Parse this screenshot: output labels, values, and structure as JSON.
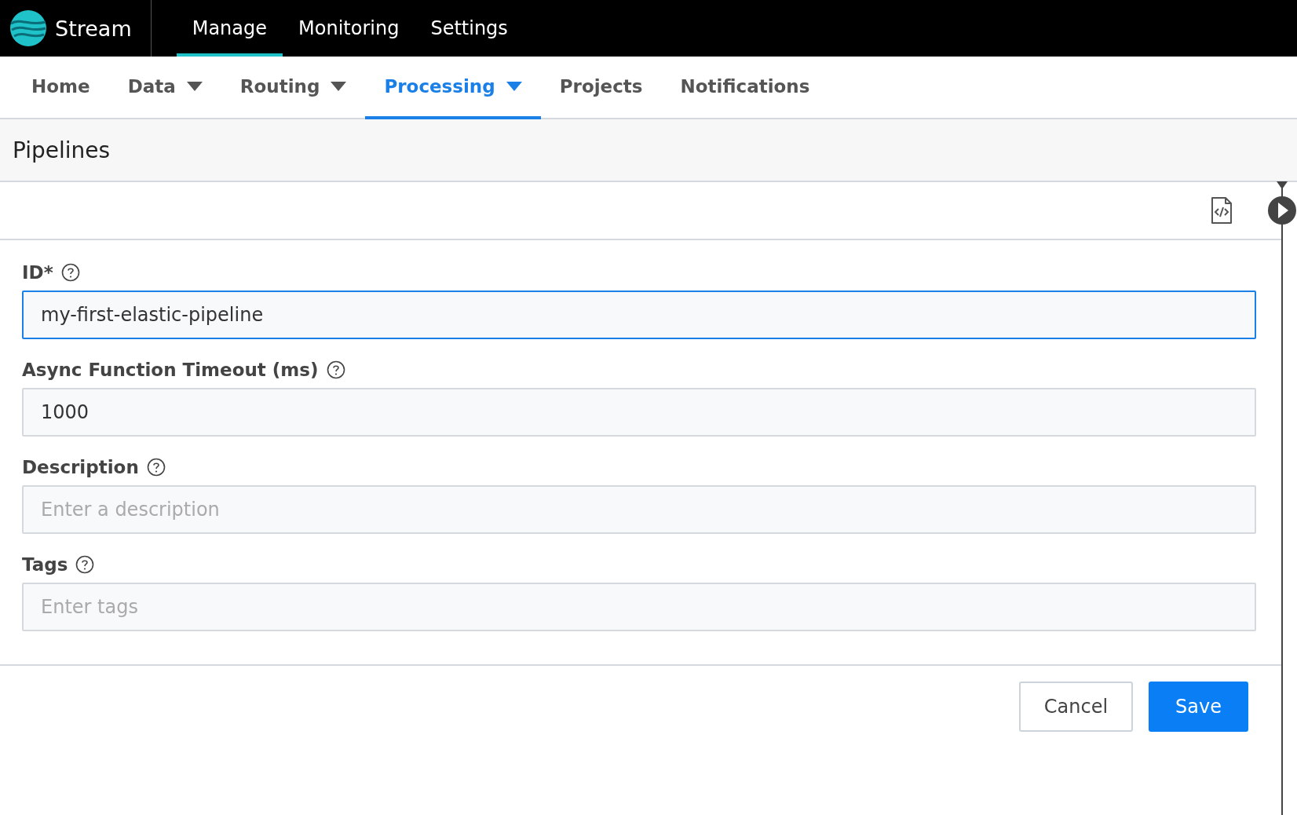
{
  "brand": {
    "name": "Stream"
  },
  "top_nav": [
    {
      "label": "Manage",
      "selected": true
    },
    {
      "label": "Monitoring",
      "selected": false
    },
    {
      "label": "Settings",
      "selected": false
    }
  ],
  "sub_nav": [
    {
      "label": "Home",
      "dropdown": false,
      "selected": false
    },
    {
      "label": "Data",
      "dropdown": true,
      "selected": false
    },
    {
      "label": "Routing",
      "dropdown": true,
      "selected": false
    },
    {
      "label": "Processing",
      "dropdown": true,
      "selected": true
    },
    {
      "label": "Projects",
      "dropdown": false,
      "selected": false
    },
    {
      "label": "Notifications",
      "dropdown": false,
      "selected": false
    }
  ],
  "page": {
    "title": "Pipelines"
  },
  "form": {
    "fields": [
      {
        "label": "ID*",
        "value": "my-first-elastic-pipeline",
        "focused": true
      },
      {
        "label": "Async Function Timeout (ms)",
        "value": "1000",
        "focused": false
      },
      {
        "label": "Description",
        "placeholder": "Enter a description",
        "focused": false
      },
      {
        "label": "Tags",
        "placeholder": "Enter tags",
        "focused": false
      }
    ]
  },
  "buttons": [
    {
      "label": "Cancel",
      "kind": "secondary"
    },
    {
      "label": "Save",
      "kind": "primary"
    }
  ]
}
